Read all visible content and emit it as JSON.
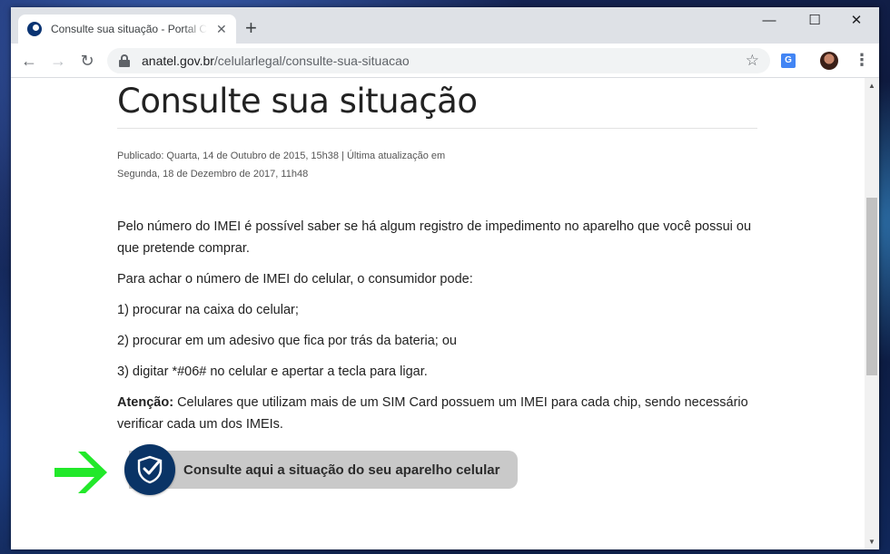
{
  "browser": {
    "tab": {
      "title": "Consulte sua situação - Portal Celular Legal",
      "close": "✕"
    },
    "new_tab": "+",
    "window_controls": {
      "minimize": "—",
      "maximize": "☐",
      "close": "✕"
    },
    "nav": {
      "back": "←",
      "forward": "→",
      "reload": "↻"
    },
    "address": {
      "host": "anatel.gov.br",
      "path": "/celularlegal/consulte-sua-situacao"
    },
    "bookmark": "☆",
    "translate_label": "G",
    "menu": "⋮"
  },
  "page": {
    "title": "Consulte sua situação",
    "meta_line1": "Publicado: Quarta, 14 de Outubro de 2015, 15h38 | Última atualização em",
    "meta_line2": "Segunda, 18 de Dezembro de 2017, 11h48",
    "paragraphs": [
      "Pelo número do IMEI é possível saber se há algum registro de impedimento no aparelho que você possui ou que pretende comprar.",
      "Para achar o número de IMEI do celular, o consumidor pode:",
      "1) procurar na caixa do celular;",
      "2) procurar em um adesivo que fica por trás da bateria; ou",
      "3) digitar *#06# no celular e apertar a tecla para ligar."
    ],
    "attention_label": "Atenção:",
    "attention_text": " Celulares que utilizam mais de um SIM Card possuem um IMEI para cada chip, sendo necessário verificar cada um dos IMEIs.",
    "cta_label": "Consulte aqui a situação do seu aparelho celular"
  },
  "colors": {
    "cta_badge": "#0a3466",
    "cta_bg": "#c9c9c9",
    "arrow": "#22e82a"
  },
  "icons": [
    "shield-check-icon",
    "arrow-right-icon",
    "lock-icon",
    "star-icon",
    "translate-icon"
  ]
}
